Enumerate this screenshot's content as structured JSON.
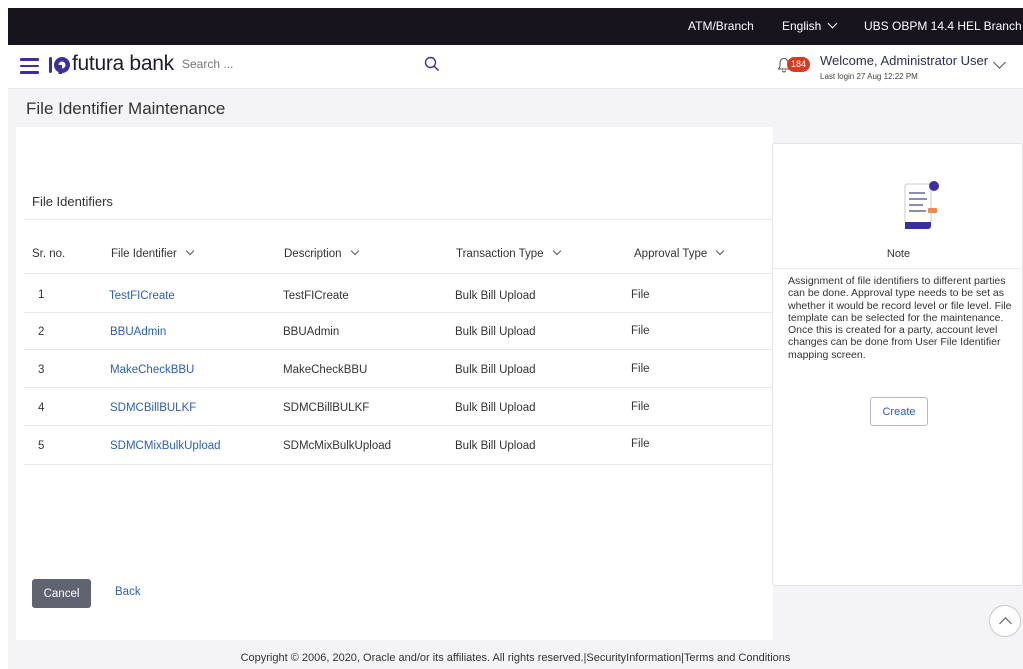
{
  "topbar": {
    "atm_branch": "ATM/Branch",
    "language": "English",
    "branch": "UBS OBPM 14.4 HEL Branch"
  },
  "header": {
    "brand": "futura bank",
    "search_placeholder": "Search ...",
    "notification_count": "184",
    "welcome": "Welcome, Administrator User",
    "last_login": "Last login 27 Aug 12:22 PM"
  },
  "page": {
    "title": "File Identifier Maintenance",
    "section_title": "File Identifiers"
  },
  "table": {
    "columns": [
      "Sr. no.",
      "File Identifier",
      "Description",
      "Transaction Type",
      "Approval Type"
    ],
    "rows": [
      {
        "sr": "1",
        "identifier": "TestFICreate",
        "description": "TestFICreate",
        "transaction_type": "Bulk Bill Upload",
        "approval_type": "File"
      },
      {
        "sr": "2",
        "identifier": "BBUAdmin",
        "description": "BBUAdmin",
        "transaction_type": "Bulk Bill Upload",
        "approval_type": "File"
      },
      {
        "sr": "3",
        "identifier": "MakeCheckBBU",
        "description": "MakeCheckBBU",
        "transaction_type": "Bulk Bill Upload",
        "approval_type": "File"
      },
      {
        "sr": "4",
        "identifier": "SDMCBillBULKF",
        "description": "SDMCBillBULKF",
        "transaction_type": "Bulk Bill Upload",
        "approval_type": "File"
      },
      {
        "sr": "5",
        "identifier": "SDMCMixBulkUpload",
        "description": "SDMcMixBulkUpload",
        "transaction_type": "Bulk Bill Upload",
        "approval_type": "File"
      }
    ]
  },
  "actions": {
    "cancel": "Cancel",
    "back": "Back"
  },
  "note": {
    "title": "Note",
    "text": "Assignment of file identifiers to different parties can be done. Approval type needs to be set as whether it would be record level or file level. File template can be selected for the maintenance. Once this is created for a party, account level changes can be done from User File Identifier mapping screen.",
    "create": "Create"
  },
  "footer": {
    "text": "Copyright © 2006, 2020, Oracle and/or its affiliates. All rights reserved.|SecurityInformation|Terms and Conditions"
  },
  "colors": {
    "topbar_bg": "#17141d",
    "brand_accent": "#3b2fa0",
    "link": "#2b5fb8",
    "badge": "#d83a22",
    "cancel_button": "#5f6470"
  },
  "icons": [
    "hamburger-icon",
    "futura-logo-icon",
    "search-icon",
    "bell-icon",
    "note-document-icon",
    "scroll-top-icon"
  ]
}
